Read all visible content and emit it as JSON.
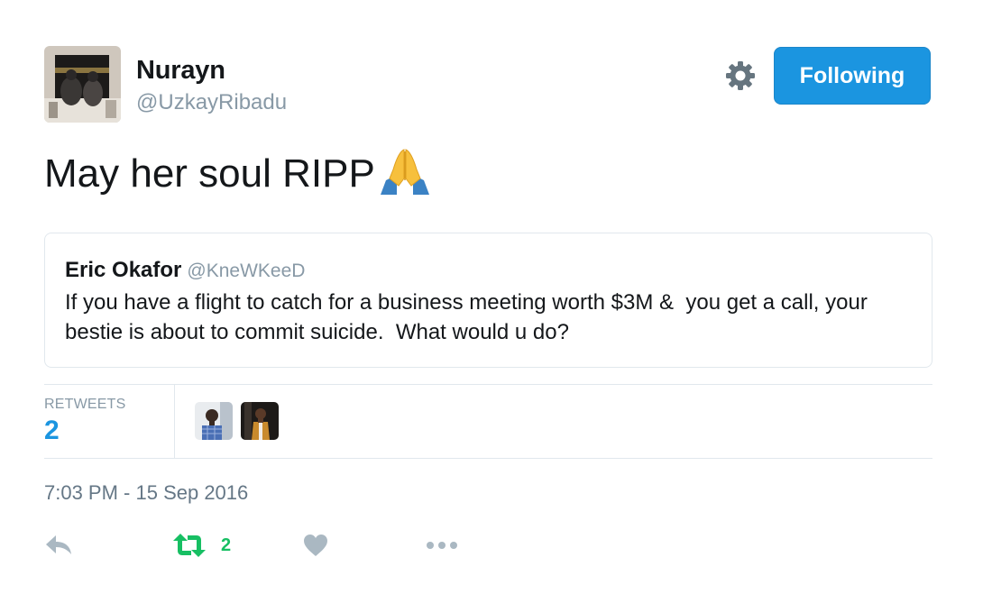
{
  "author": {
    "name": "Nurayn",
    "handle": "@UzkayRibadu"
  },
  "follow_button": {
    "label": "Following"
  },
  "tweet": {
    "text": "May her soul RIPP",
    "emoji": "folded-hands-icon"
  },
  "quoted_tweet": {
    "name": "Eric Okafor",
    "handle": "@KneWKeeD",
    "text": "If you have a flight to catch for a business meeting worth $3M &  you get a call, your bestie is about to commit suicide.  What would u do?"
  },
  "stats": {
    "retweets_label": "RETWEETS",
    "retweets_count": "2"
  },
  "timestamp": "7:03 PM - 15 Sep 2016",
  "actions": {
    "reply": "reply-icon",
    "retweet": "retweet-icon",
    "retweet_count": "2",
    "like": "heart-icon",
    "more": "more-icon"
  },
  "colors": {
    "accent": "#1b95e0",
    "retweet_green": "#17bf63",
    "muted": "#8899a6",
    "border": "#e1e8ed"
  }
}
